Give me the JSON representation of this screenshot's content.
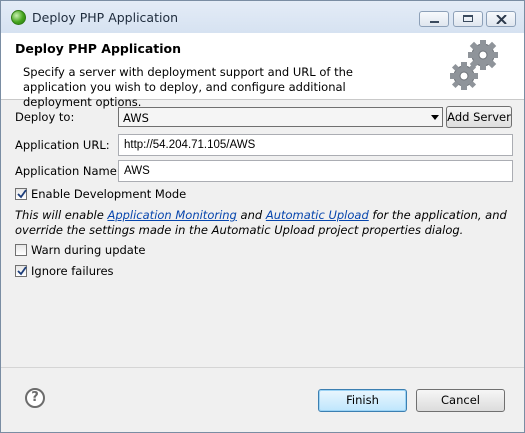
{
  "window": {
    "title": "Deploy PHP Application"
  },
  "header": {
    "title": "Deploy PHP Application",
    "description": "Specify a server with deployment support and URL of the application you wish to deploy, and configure additional deployment options."
  },
  "form": {
    "deploy_to_label": "Deploy to:",
    "deploy_to_value": "AWS",
    "add_server_label": "Add Server",
    "app_url_label": "Application URL:",
    "app_url_value": "http://54.204.71.105/AWS",
    "app_name_label": "Application Name:",
    "app_name_value": "AWS",
    "dev_mode_label": "Enable Development Mode",
    "dev_mode_checked": true,
    "info_prefix": "This will enable ",
    "info_link1": "Application Monitoring",
    "info_mid": " and ",
    "info_link2": "Automatic Upload",
    "info_suffix": " for the application, and override the settings made in the Automatic Upload project properties dialog.",
    "warn_label": "Warn during update",
    "warn_checked": false,
    "ignore_label": "Ignore failures",
    "ignore_checked": true
  },
  "footer": {
    "help_symbol": "?",
    "finish_label": "Finish",
    "cancel_label": "Cancel"
  },
  "icons": {
    "app": "php-app-icon",
    "header": "gears-icon",
    "help": "help-icon"
  }
}
